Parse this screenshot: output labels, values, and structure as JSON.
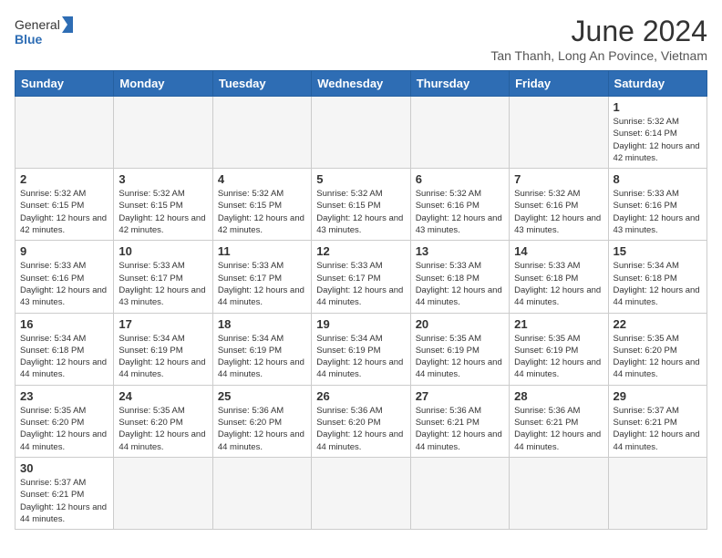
{
  "header": {
    "logo_general": "General",
    "logo_blue": "Blue",
    "title": "June 2024",
    "subtitle": "Tan Thanh, Long An Povince, Vietnam"
  },
  "weekdays": [
    "Sunday",
    "Monday",
    "Tuesday",
    "Wednesday",
    "Thursday",
    "Friday",
    "Saturday"
  ],
  "weeks": [
    [
      {
        "day": "",
        "info": ""
      },
      {
        "day": "",
        "info": ""
      },
      {
        "day": "",
        "info": ""
      },
      {
        "day": "",
        "info": ""
      },
      {
        "day": "",
        "info": ""
      },
      {
        "day": "",
        "info": ""
      },
      {
        "day": "1",
        "info": "Sunrise: 5:32 AM\nSunset: 6:14 PM\nDaylight: 12 hours and 42 minutes."
      }
    ],
    [
      {
        "day": "2",
        "info": "Sunrise: 5:32 AM\nSunset: 6:15 PM\nDaylight: 12 hours and 42 minutes."
      },
      {
        "day": "3",
        "info": "Sunrise: 5:32 AM\nSunset: 6:15 PM\nDaylight: 12 hours and 42 minutes."
      },
      {
        "day": "4",
        "info": "Sunrise: 5:32 AM\nSunset: 6:15 PM\nDaylight: 12 hours and 42 minutes."
      },
      {
        "day": "5",
        "info": "Sunrise: 5:32 AM\nSunset: 6:15 PM\nDaylight: 12 hours and 43 minutes."
      },
      {
        "day": "6",
        "info": "Sunrise: 5:32 AM\nSunset: 6:16 PM\nDaylight: 12 hours and 43 minutes."
      },
      {
        "day": "7",
        "info": "Sunrise: 5:32 AM\nSunset: 6:16 PM\nDaylight: 12 hours and 43 minutes."
      },
      {
        "day": "8",
        "info": "Sunrise: 5:33 AM\nSunset: 6:16 PM\nDaylight: 12 hours and 43 minutes."
      }
    ],
    [
      {
        "day": "9",
        "info": "Sunrise: 5:33 AM\nSunset: 6:16 PM\nDaylight: 12 hours and 43 minutes."
      },
      {
        "day": "10",
        "info": "Sunrise: 5:33 AM\nSunset: 6:17 PM\nDaylight: 12 hours and 43 minutes."
      },
      {
        "day": "11",
        "info": "Sunrise: 5:33 AM\nSunset: 6:17 PM\nDaylight: 12 hours and 44 minutes."
      },
      {
        "day": "12",
        "info": "Sunrise: 5:33 AM\nSunset: 6:17 PM\nDaylight: 12 hours and 44 minutes."
      },
      {
        "day": "13",
        "info": "Sunrise: 5:33 AM\nSunset: 6:18 PM\nDaylight: 12 hours and 44 minutes."
      },
      {
        "day": "14",
        "info": "Sunrise: 5:33 AM\nSunset: 6:18 PM\nDaylight: 12 hours and 44 minutes."
      },
      {
        "day": "15",
        "info": "Sunrise: 5:34 AM\nSunset: 6:18 PM\nDaylight: 12 hours and 44 minutes."
      }
    ],
    [
      {
        "day": "16",
        "info": "Sunrise: 5:34 AM\nSunset: 6:18 PM\nDaylight: 12 hours and 44 minutes."
      },
      {
        "day": "17",
        "info": "Sunrise: 5:34 AM\nSunset: 6:19 PM\nDaylight: 12 hours and 44 minutes."
      },
      {
        "day": "18",
        "info": "Sunrise: 5:34 AM\nSunset: 6:19 PM\nDaylight: 12 hours and 44 minutes."
      },
      {
        "day": "19",
        "info": "Sunrise: 5:34 AM\nSunset: 6:19 PM\nDaylight: 12 hours and 44 minutes."
      },
      {
        "day": "20",
        "info": "Sunrise: 5:35 AM\nSunset: 6:19 PM\nDaylight: 12 hours and 44 minutes."
      },
      {
        "day": "21",
        "info": "Sunrise: 5:35 AM\nSunset: 6:19 PM\nDaylight: 12 hours and 44 minutes."
      },
      {
        "day": "22",
        "info": "Sunrise: 5:35 AM\nSunset: 6:20 PM\nDaylight: 12 hours and 44 minutes."
      }
    ],
    [
      {
        "day": "23",
        "info": "Sunrise: 5:35 AM\nSunset: 6:20 PM\nDaylight: 12 hours and 44 minutes."
      },
      {
        "day": "24",
        "info": "Sunrise: 5:35 AM\nSunset: 6:20 PM\nDaylight: 12 hours and 44 minutes."
      },
      {
        "day": "25",
        "info": "Sunrise: 5:36 AM\nSunset: 6:20 PM\nDaylight: 12 hours and 44 minutes."
      },
      {
        "day": "26",
        "info": "Sunrise: 5:36 AM\nSunset: 6:20 PM\nDaylight: 12 hours and 44 minutes."
      },
      {
        "day": "27",
        "info": "Sunrise: 5:36 AM\nSunset: 6:21 PM\nDaylight: 12 hours and 44 minutes."
      },
      {
        "day": "28",
        "info": "Sunrise: 5:36 AM\nSunset: 6:21 PM\nDaylight: 12 hours and 44 minutes."
      },
      {
        "day": "29",
        "info": "Sunrise: 5:37 AM\nSunset: 6:21 PM\nDaylight: 12 hours and 44 minutes."
      }
    ],
    [
      {
        "day": "30",
        "info": "Sunrise: 5:37 AM\nSunset: 6:21 PM\nDaylight: 12 hours and 44 minutes."
      },
      {
        "day": "",
        "info": ""
      },
      {
        "day": "",
        "info": ""
      },
      {
        "day": "",
        "info": ""
      },
      {
        "day": "",
        "info": ""
      },
      {
        "day": "",
        "info": ""
      },
      {
        "day": "",
        "info": ""
      }
    ]
  ]
}
